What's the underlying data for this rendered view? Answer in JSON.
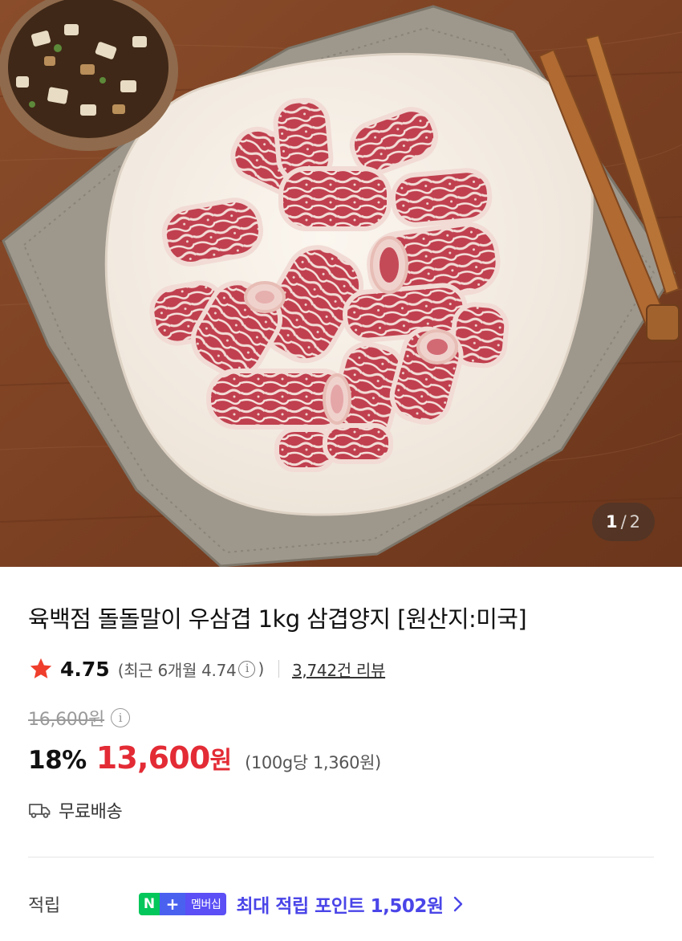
{
  "gallery": {
    "current": "1",
    "separator": "/",
    "total": "2"
  },
  "product": {
    "title": "육백점 돌돌말이 우삼겹 1kg 삼겹양지 [원산지:미국]",
    "rating": "4.75",
    "recent_rating_text": "(최근 6개월 4.74",
    "recent_rating_close": ")",
    "reviews": "3,742건 리뷰",
    "original_price": "16,600원",
    "discount": "18%",
    "sale_price": "13,600",
    "sale_unit": "원",
    "unit_price": "(100g당 1,360원)",
    "shipping": "무료배송"
  },
  "points": {
    "label": "적립",
    "badge_n": "N",
    "badge_plus": "+",
    "badge_text": "멤버십",
    "text": "최대 적립 포인트 1,502원"
  },
  "colors": {
    "sale": "#e32b35",
    "star": "#ef3e2c",
    "points": "#4a45e8",
    "naver_green": "#03c75a"
  },
  "icons": {
    "star": "star-icon",
    "info": "info-icon",
    "truck": "truck-icon",
    "chevron": "chevron-right-icon"
  }
}
